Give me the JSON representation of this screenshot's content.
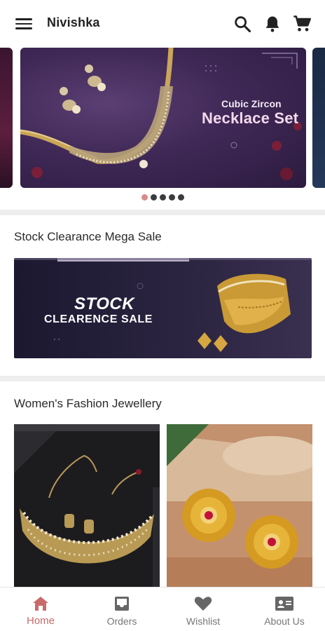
{
  "app": {
    "title": "Nivishka"
  },
  "topbar": {
    "icons": [
      "menu-icon",
      "search-icon",
      "bell-icon",
      "cart-icon"
    ]
  },
  "carousel": {
    "slides": [
      {
        "subtitle": "Cubic Zircon",
        "title": "Necklace Set"
      }
    ],
    "dot_count": 5,
    "active_index": 0,
    "active_dot_color": "#d98a8a"
  },
  "sections": {
    "stock": {
      "title": "Stock Clearance Mega Sale",
      "banner_line1": "STOCK",
      "banner_line2": "CLEARENCE SALE"
    },
    "womens": {
      "title": "Women's Fashion Jewellery"
    }
  },
  "bottom_nav": {
    "items": [
      {
        "label": "Home",
        "icon": "home-icon",
        "active": true
      },
      {
        "label": "Orders",
        "icon": "inbox-icon",
        "active": false
      },
      {
        "label": "Wishlist",
        "icon": "heart-icon",
        "active": false
      },
      {
        "label": "About Us",
        "icon": "contact-card-icon",
        "active": false
      }
    ],
    "active_color": "#c96a6a"
  }
}
